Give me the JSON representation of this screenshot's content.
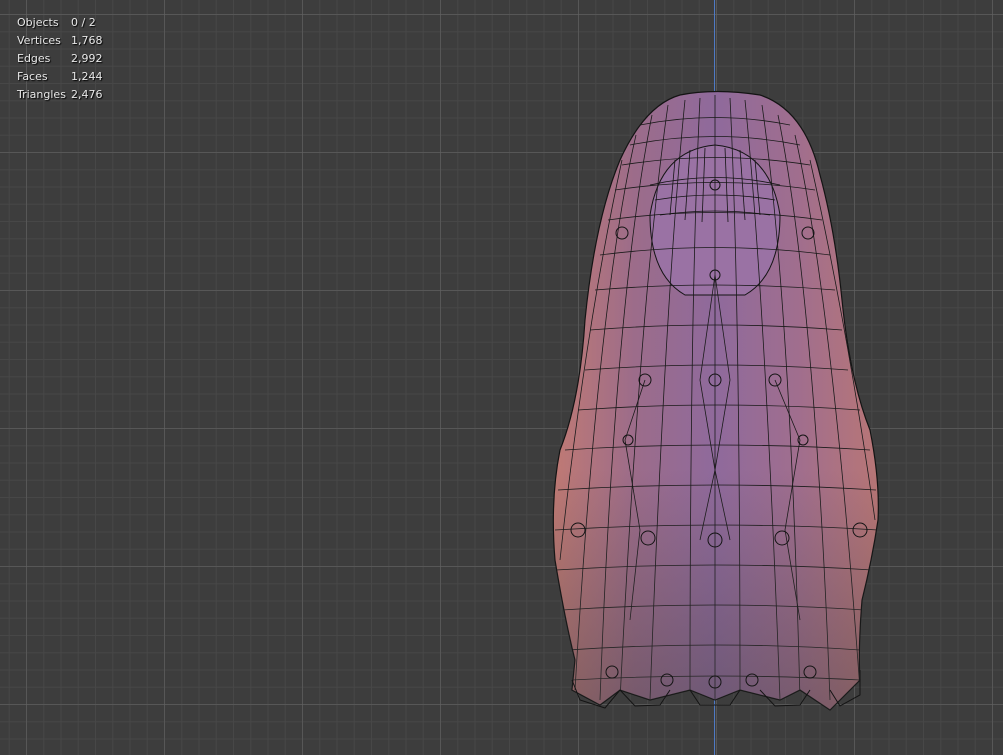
{
  "stats": {
    "objects": {
      "label": "Objects",
      "value": "0 / 2"
    },
    "vertices": {
      "label": "Vertices",
      "value": "1,768"
    },
    "edges": {
      "label": "Edges",
      "value": "2,992"
    },
    "faces": {
      "label": "Faces",
      "value": "1,244"
    },
    "triangles": {
      "label": "Triangles",
      "value": "2,476"
    }
  },
  "colors": {
    "background": "#3d3d3d",
    "axis": "#4f7ac4",
    "mesh_shade": "#a07aa0",
    "wire": "#141414"
  }
}
